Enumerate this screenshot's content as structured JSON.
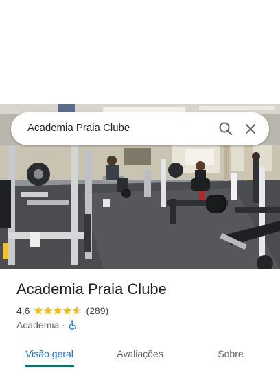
{
  "search": {
    "query": "Academia Praia Clube",
    "search_icon": "search-icon",
    "close_icon": "close-icon"
  },
  "photo": {
    "subject": "gym-interior-photo"
  },
  "place": {
    "name": "Academia Praia Clube",
    "rating": "4,6",
    "rating_value": 4.6,
    "stars_icon": "star-icon",
    "review_count": "(289)",
    "category": "Academia",
    "separator": "·",
    "accessibility_icon": "wheelchair-icon"
  },
  "tabs": [
    {
      "label": "Visão geral",
      "active": true
    },
    {
      "label": "Avaliações",
      "active": false
    },
    {
      "label": "Sobre",
      "active": false
    }
  ],
  "colors": {
    "accent": "#00796b",
    "star": "#fbbc04",
    "accessible": "#1a73e8"
  }
}
